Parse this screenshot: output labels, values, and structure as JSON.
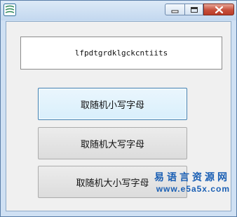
{
  "window": {
    "icon": "app-icon",
    "controls": {
      "minimize_icon": "minimize-icon",
      "maximize_icon": "maximize-icon",
      "close_icon": "close-icon"
    }
  },
  "result": {
    "text": "lfpdtgrdklgckcntiits"
  },
  "buttons": [
    {
      "label": "取随机小写字母"
    },
    {
      "label": "取随机大写字母"
    },
    {
      "label": "取随机大小写字母"
    }
  ],
  "watermark": {
    "title": "易语言资源网",
    "url": "www.e5a5x.com",
    "color": "#1a5fb4"
  },
  "colors": {
    "close_button": "#c7503c",
    "focused_button": "#d9effc"
  }
}
